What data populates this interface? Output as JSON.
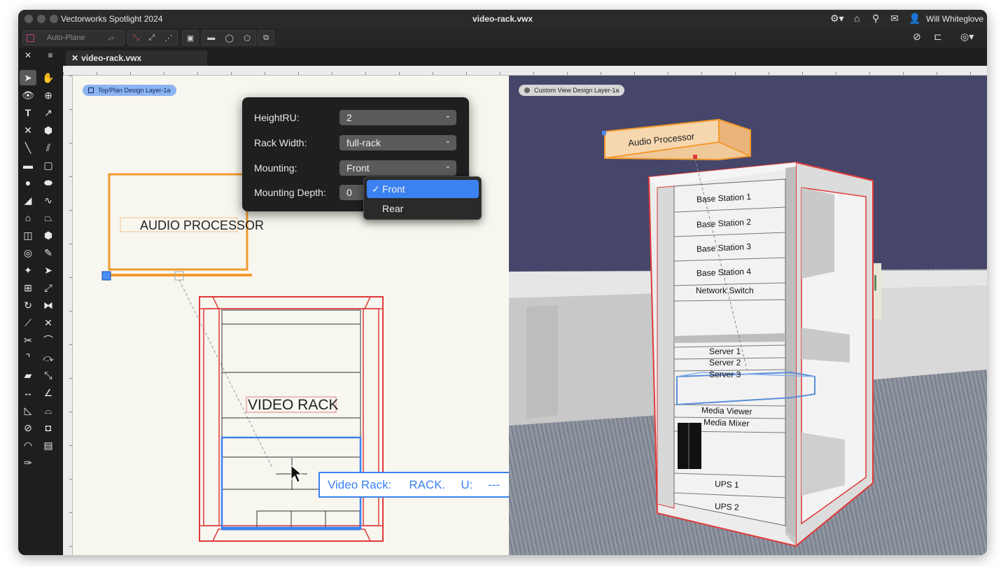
{
  "titlebar": {
    "app_name": "Vectorworks Spotlight 2024",
    "doc_title": "video-rack.vwx",
    "user_name": "Will Whiteglove",
    "icons": [
      "gear-icon",
      "home-icon",
      "search-icon",
      "mail-icon",
      "user-icon"
    ]
  },
  "toolbar": {
    "auto_plane_label": "Auto-Plane"
  },
  "tabbar": {
    "close_glyph": "✕",
    "tab_label": "video-rack.vwx"
  },
  "left_view": {
    "badge": "Top/Plan  Design Layer-1a",
    "audio_label": "AUDIO PROCESSOR",
    "rack_label": "VIDEO RACK",
    "tooltip": {
      "name": "Video Rack:",
      "type": "RACK.",
      "u_label": "U:",
      "u_value": "---"
    }
  },
  "right_view": {
    "badge": "Custom View  Design Layer-1a",
    "audio_label": "Audio Processor",
    "rack_items": [
      "Base Station 1",
      "Base Station 2",
      "Base Station 3",
      "Base Station 4",
      "Network Switch",
      "Server 1",
      "Server 2",
      "Server 3",
      "Media Viewer",
      "Media Mixer",
      "UPS 1",
      "UPS 2"
    ]
  },
  "popup": {
    "height_label": "HeightRU:",
    "height_value": "2",
    "width_label": "Rack Width:",
    "width_value": "full-rack",
    "mounting_label": "Mounting:",
    "mounting_value": "Front",
    "depth_label": "Mounting Depth:",
    "depth_value": "0"
  },
  "dropdown": {
    "options": [
      "Front",
      "Rear"
    ],
    "selected": "Front"
  },
  "colors": {
    "selection_blue": "#3b82f0",
    "rack_red": "#e03a3a",
    "audio_orange": "#f29a2e"
  }
}
